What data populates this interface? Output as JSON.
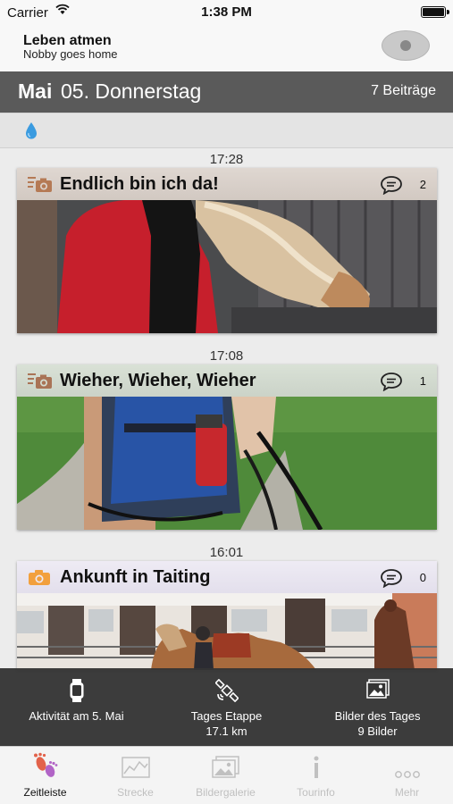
{
  "status_bar": {
    "carrier": "Carrier",
    "time": "1:38 PM"
  },
  "header": {
    "title": "Leben atmen",
    "subtitle": "Nobby goes home"
  },
  "date_bar": {
    "month": "Mai",
    "day": "05. Donnerstag",
    "entries": "7 Beiträge"
  },
  "timeline": [
    {
      "time": "17:28",
      "title": "Endlich bin ich da!",
      "comments": "2",
      "type_icon": "photo-entry-icon",
      "accent": "#d9d0c9",
      "icon_color": "#b57a55"
    },
    {
      "time": "17:08",
      "title": "Wieher, Wieher, Wieher",
      "comments": "1",
      "type_icon": "photo-entry-icon",
      "accent": "#d4ddd2",
      "icon_color": "#a97356"
    },
    {
      "time": "16:01",
      "title": "Ankunft in Taiting",
      "comments": "0",
      "type_icon": "camera-icon",
      "accent": "#e9e6f1",
      "icon_color": "#f2a03d"
    }
  ],
  "info_panel": {
    "activity": {
      "label": "Aktivität am 5. Mai",
      "icon": "watch-icon"
    },
    "stage": {
      "label": "Tages Etappe",
      "value": "17.1 km",
      "icon": "satellite-icon"
    },
    "pictures": {
      "label": "Bilder des Tages",
      "value": "9 Bilder",
      "icon": "photo-icon"
    }
  },
  "tabs": [
    {
      "label": "Zeitleiste",
      "icon": "footprints-icon",
      "active": true
    },
    {
      "label": "Strecke",
      "icon": "map-icon",
      "active": false
    },
    {
      "label": "Bildergalerie",
      "icon": "gallery-icon",
      "active": false
    },
    {
      "label": "Tourinfo",
      "icon": "info-icon",
      "active": false
    },
    {
      "label": "Mehr",
      "icon": "more-icon",
      "active": false
    }
  ],
  "colors": {
    "date_bar": "#5a5a5a",
    "info_panel": "#343434",
    "active_tab_icon": "#e2624a"
  }
}
